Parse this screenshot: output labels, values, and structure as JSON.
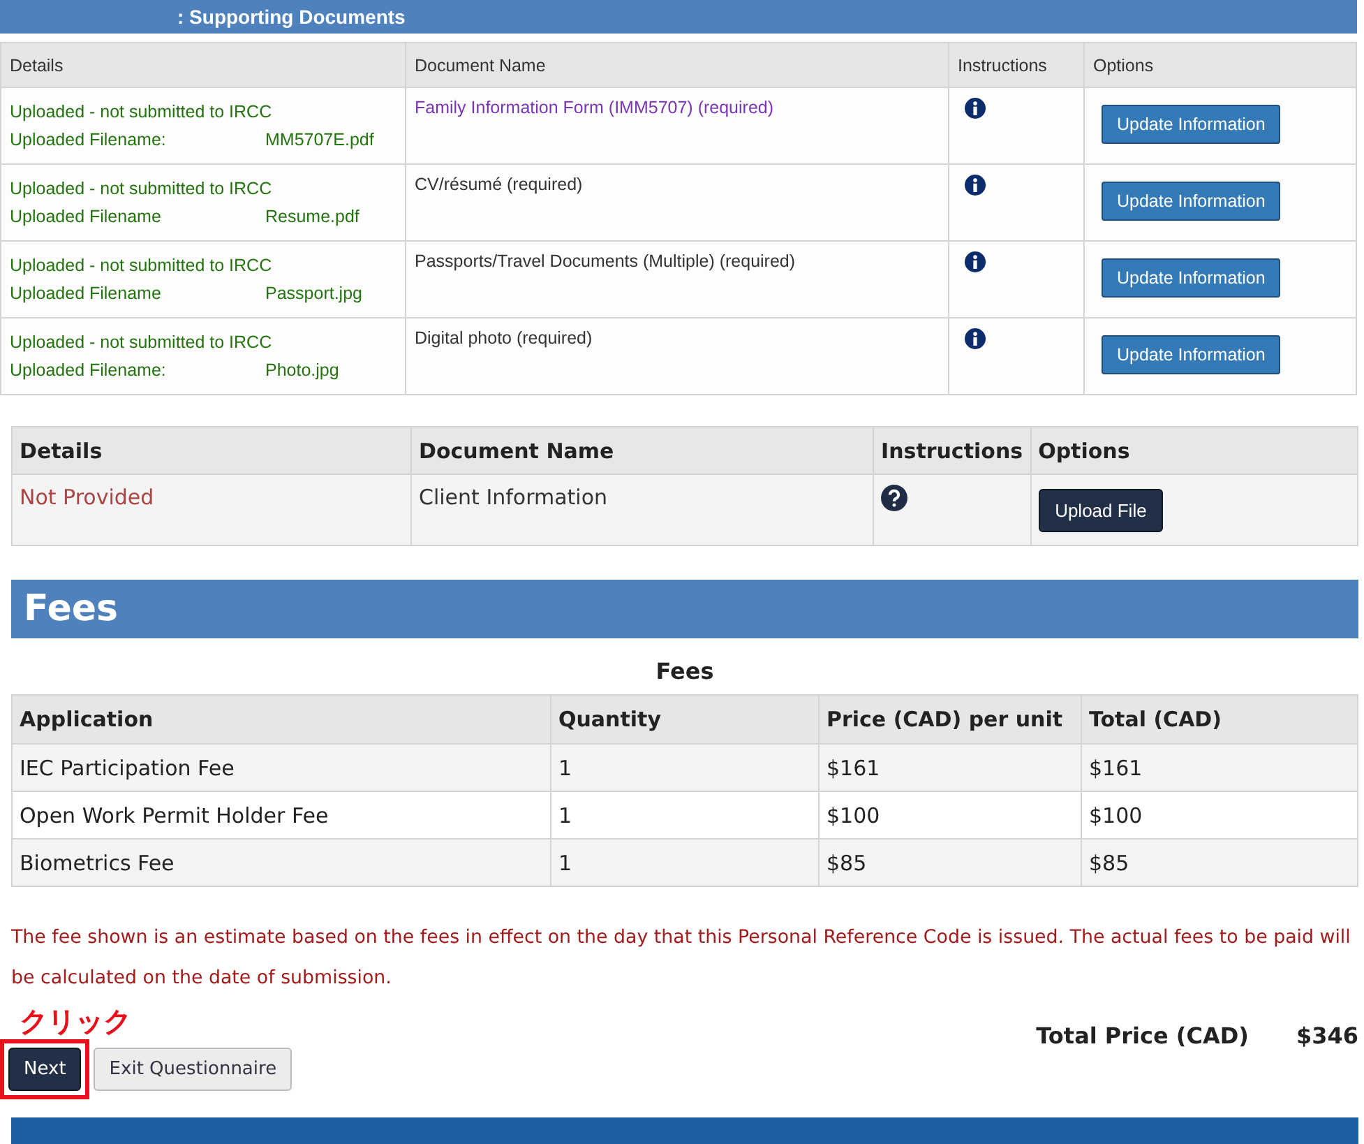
{
  "section_title": ": Supporting Documents",
  "documents_table": {
    "columns": [
      "Details",
      "Document Name",
      "Instructions",
      "Options"
    ],
    "rows": [
      {
        "status": "Uploaded - not submitted to IRCC",
        "filename_label": "Uploaded Filename:",
        "filename": "MM5707E.pdf",
        "document": "Family Information Form (IMM5707)  (required)",
        "kind": "link",
        "button": "Update Information"
      },
      {
        "status": "Uploaded - not submitted to IRCC",
        "filename_label": "Uploaded Filename",
        "filename": "Resume.pdf",
        "document": "CV/résumé  (required)",
        "kind": "text",
        "button": "Update Information"
      },
      {
        "status": "Uploaded - not submitted to IRCC",
        "filename_label": "Uploaded Filename",
        "filename": "Passport.jpg",
        "document": "Passports/Travel Documents (Multiple)  (required)",
        "kind": "text",
        "button": "Update Information"
      },
      {
        "status": "Uploaded - not submitted to IRCC",
        "filename_label": "Uploaded Filename:",
        "filename": "Photo.jpg",
        "document": "Digital photo  (required)",
        "kind": "text",
        "button": "Update Information"
      }
    ]
  },
  "client_table": {
    "columns": [
      "Details",
      "Document Name",
      "Instructions",
      "Options"
    ],
    "rows": [
      {
        "status": "Not Provided",
        "document": "Client Information",
        "button": "Upload File"
      }
    ]
  },
  "fees_heading": "Fees",
  "fees_table": {
    "caption": "Fees",
    "columns": [
      "Application",
      "Quantity",
      "Price (CAD) per unit",
      "Total (CAD)"
    ],
    "rows": [
      [
        "IEC Participation Fee",
        "1",
        "$161",
        "$161"
      ],
      [
        "Open Work Permit Holder Fee",
        "1",
        "$100",
        "$100"
      ],
      [
        "Biometrics Fee",
        "1",
        "$85",
        "$85"
      ]
    ]
  },
  "fee_note": "The fee shown is an estimate based on the fees in effect on the day that this Personal Reference Code is issued. The actual fees to be paid will be calculated on the date of submission.",
  "annotation": "クリック",
  "total": {
    "label": "Total Price (CAD)",
    "value": "$346"
  },
  "buttons": [
    "Next",
    "Exit Questionnaire"
  ]
}
